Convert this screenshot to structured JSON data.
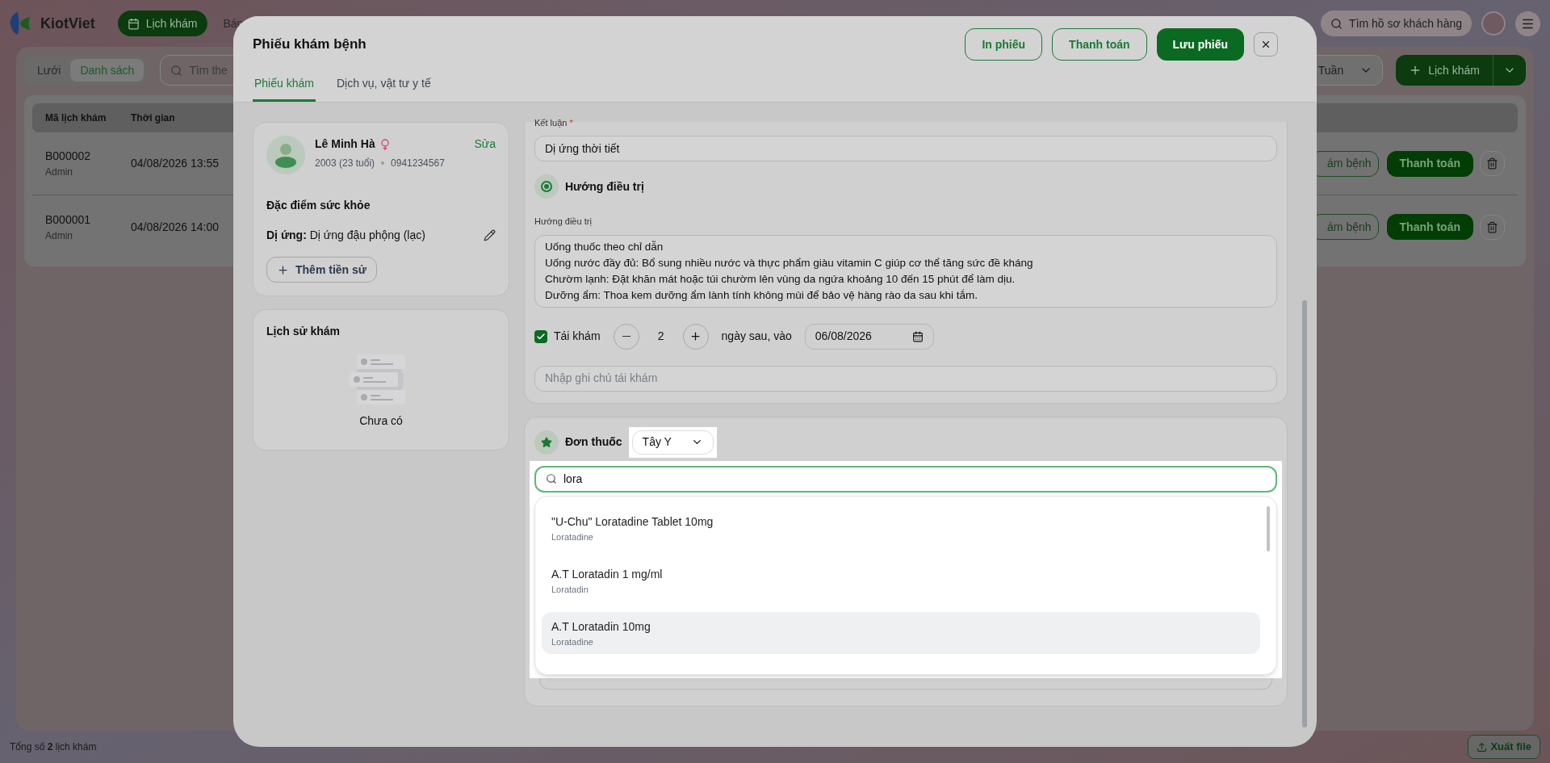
{
  "app": {
    "logo": "KiotViet",
    "nav": [
      {
        "label": "Lịch khám",
        "selected": true
      },
      {
        "label": "Bán",
        "selected": false
      }
    ],
    "customer_search": {
      "placeholder": "Tìm hồ sơ khách hàng"
    }
  },
  "toolbar": {
    "view_tabs": [
      {
        "label": "Lưới",
        "selected": false
      },
      {
        "label": "Danh sách",
        "selected": true
      }
    ],
    "search": {
      "placeholder": "Tìm the"
    },
    "period": "Tuần",
    "add_button": "Lịch khám"
  },
  "table": {
    "columns": [
      "Mã lịch khám",
      "Thời gian"
    ],
    "rows": [
      {
        "code": "B000002",
        "creator": "Admin",
        "time": "04/08/2026 13:55",
        "action_1": "ám bệnh",
        "action_2": "Thanh toán"
      },
      {
        "code": "B000001",
        "creator": "Admin",
        "time": "04/08/2026 14:00",
        "action_1": "ám bệnh",
        "action_2": "Thanh toán"
      }
    ]
  },
  "footer": {
    "total": "Tổng số **2** lịch khám",
    "export_button": "Xuất file"
  },
  "modal": {
    "title": "Phiếu khám bệnh",
    "buttons": [
      {
        "label": "In phiếu",
        "kind": "outline"
      },
      {
        "label": "Thanh toán",
        "kind": "outline"
      },
      {
        "label": "Lưu phiếu",
        "kind": "primary"
      }
    ],
    "tabs": [
      {
        "label": "Phiếu khám",
        "selected": true
      },
      {
        "label": "Dịch vụ, vật tư y tế",
        "selected": false
      }
    ],
    "patient": {
      "name": "Lê Minh Hà",
      "birth": "2003 (23 tuổi)",
      "phone": "0941234567",
      "edit": "Sửa"
    },
    "health": {
      "title": "Đặc điểm sức khỏe",
      "items": [
        {
          "label": "Dị ứng:",
          "value": "Dị ứng đậu phộng (lạc)"
        }
      ],
      "add_button": "Thêm tiền sử"
    },
    "history": {
      "title": "Lịch sử khám",
      "empty": "Chưa có"
    },
    "conclusion": {
      "label": "Kết luận",
      "required_mark": "*",
      "value": "Dị ứng thời tiết"
    },
    "treatment": {
      "title": "Hướng điều trị",
      "field_label": "Hướng điều trị",
      "value": "Uống thuốc theo chỉ dẫn\nUống nước đầy đủ: Bổ sung nhiều nước và thực phẩm giàu vitamin C giúp cơ thể tăng sức đề kháng\nChườm lạnh: Đặt khăn mát hoặc túi chườm lên vùng da ngứa khoảng 10 đến 15 phút để làm dịu.\nDưỡng ẩm: Thoa kem dưỡng ẩm lành tính không mùi để bảo vệ hàng rào da sau khi tắm."
    },
    "follow_up": {
      "checked": true,
      "label": "Tái khám",
      "days": "2",
      "after_text": "ngày sau, vào",
      "date": "06/08/2026",
      "note_placeholder": "Nhập ghi chú tái khám"
    },
    "prescription": {
      "title": "Đơn thuốc",
      "type": "Tây Y",
      "search": {
        "value": "lora"
      },
      "results": [
        {
          "name": "\"U-Chu\" Loratadine Tablet 10mg",
          "ingredient": "Loratadine",
          "selected": false
        },
        {
          "name": "A.T Loratadin 1 mg/ml",
          "ingredient": "Loratadin",
          "selected": false
        },
        {
          "name": "A.T Loratadin 10mg",
          "ingredient": "Loratadine",
          "selected": true
        }
      ]
    }
  }
}
